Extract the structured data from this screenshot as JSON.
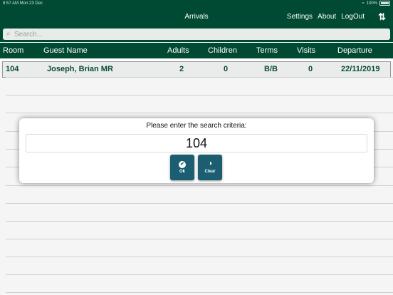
{
  "status_bar": {
    "time_date": "8:57 AM   Mon 23 Dec",
    "battery": "100%"
  },
  "nav": {
    "title": "Arrivals",
    "settings": "Settings",
    "about": "About",
    "logout": "LogOut",
    "sync_icon": "⇅"
  },
  "search": {
    "placeholder": "Search...",
    "icon": "⌕"
  },
  "table": {
    "headers": {
      "room": "Room",
      "guest": "Guest Name",
      "adults": "Adults",
      "children": "Children",
      "terms": "Terms",
      "visits": "Visits",
      "departure": "Departure"
    },
    "rows": [
      {
        "room": "104",
        "guest": "Joseph, Brian MR",
        "adults": "2",
        "children": "0",
        "terms": "B/B",
        "visits": "0",
        "departure": "22/11/2019"
      }
    ]
  },
  "dialog": {
    "prompt": "Please enter the search criteria:",
    "value": "104",
    "ok_label": "Ok",
    "ok_icon": "✔",
    "clear_label": "Clear",
    "clear_icon": "◑"
  },
  "colors": {
    "primary": "#004a33",
    "button": "#1b5e72",
    "row_text": "#0a4f38"
  }
}
